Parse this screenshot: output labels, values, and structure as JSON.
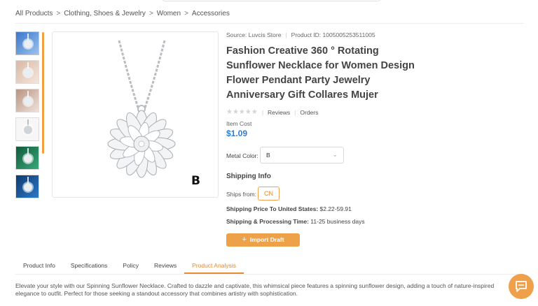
{
  "breadcrumb": [
    "All Products",
    "Clothing, Shoes & Jewelry",
    "Women",
    "Accessories"
  ],
  "product": {
    "source": "Source: Luvcis Store",
    "product_id": "Product ID: 1005005253511005",
    "title": "Fashion Creative 360 ° Rotating Sunflower Necklace for Women Design Flower Pendant Party Jewelry Anniversary Gift Collares Mujer",
    "stars": "★★★★★",
    "reviews_label": "Reviews",
    "orders_label": "Orders",
    "cost_label": "Item Cost",
    "price": "$1.09",
    "image_badge": "B"
  },
  "options": {
    "metal_color_label": "Metal Color:",
    "metal_color_value": "B"
  },
  "shipping": {
    "title": "Shipping Info",
    "ships_from_label": "Ships from:",
    "ships_from_value": "CN",
    "price_label": "Shipping Price To United States:",
    "price_value": "$2.22-59.91",
    "time_label": "Shipping & Processing Time:",
    "time_value": "11-25 business days"
  },
  "import_button": "Import Draft",
  "tabs": [
    "Product Info",
    "Specifications",
    "Policy",
    "Reviews",
    "Product Analysis"
  ],
  "active_tab": "Product Analysis",
  "description": "Elevate your style with our Spinning Sunflower Necklace. Crafted to dazzle and captivate, this whimsical piece features a spinning sunflower design, adding a touch of nature-inspired elegance to outfit. Perfect for those seeking a standout accessory that combines artistry with sophistication.",
  "colors": {
    "accent": "#e88a2e",
    "price": "#2f7bd6",
    "button": "#eda24a"
  },
  "icons": {
    "chevron": "chevron-right-icon",
    "dropdown": "chevron-down-icon",
    "plus": "plus-icon",
    "chat": "chat-icon"
  }
}
